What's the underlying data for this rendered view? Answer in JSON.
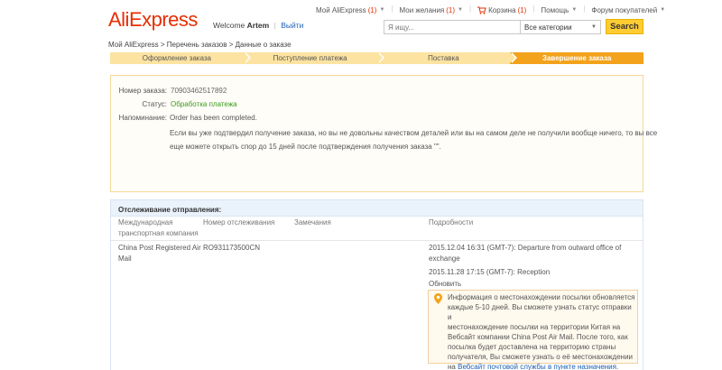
{
  "header": {
    "logo": "AliExpress",
    "welcome_prefix": "Welcome",
    "user_name": "Artem",
    "logout": "Выйти",
    "top_nav": [
      {
        "label": "Мой AliExpress",
        "count": "(1)"
      },
      {
        "label": "Мои желания",
        "count": "(1)"
      },
      {
        "label": "Корзина",
        "count": "(1)"
      },
      {
        "label": "Помощь"
      },
      {
        "label": "Форум покупателей"
      }
    ],
    "search_placeholder": "Я ищу...",
    "category": "Все категории",
    "search_button": "Search"
  },
  "breadcrumb": "Мой AliExpress > Перечень заказов > Данные о заказе",
  "steps": [
    {
      "label": "Оформление заказа",
      "active": false
    },
    {
      "label": "Поступление платежа",
      "active": false
    },
    {
      "label": "Поставка",
      "active": false
    },
    {
      "label": "Завершение заказа",
      "active": true
    }
  ],
  "order": {
    "number_label": "Номер заказа:",
    "number": "70903462517892",
    "status_label": "Статус:",
    "status": "Обработка платежа",
    "reminder_label": "Напоминание:",
    "reminder_line1": "Order has been completed.",
    "reminder_line2": "Если вы уже подтвердил получение заказа, но вы не довольны качеством деталей или вы на самом деле не получили вообще ничего, то вы все",
    "reminder_line3": "еще можете открыть спор до 15 дней после подтверждения получения заказа \"\"."
  },
  "tracking": {
    "title": "Отслеживание отправления:",
    "columns": {
      "carrier_line1": "Международная",
      "carrier_line2": "транспортная компания",
      "tracking_number": "Номер отслеживания",
      "remarks": "Замечания",
      "details": "Подробности"
    },
    "carrier_line1": "China Post Registered Air",
    "carrier_line2": "Mail",
    "tracking_number": "RO931173500CN",
    "event1_line1": "2015.12.04 16:31 (GMT-7): Departure from outward office of",
    "event1_line2": "exchange",
    "event2": "2015.11.28 17:15 (GMT-7): Reception",
    "refresh": "Обновить",
    "info": {
      "line1": "Информация о местонахождении посылки обновляется",
      "line2": "каждые 5-10 дней. Вы сможете узнать статус отправки и",
      "line3": "местонахождение посылки на территории Китая на",
      "line4": "Вебсайт компании China Post Air Mail. После того, как",
      "line5": "посылка будет доставлена на территорию страны",
      "line6": "получателя, Вы сможете узнать о её местонахождении",
      "line7_prefix": "на",
      "line7_link": "Вебсайт почтовой службы в пункте назначения",
      "line7_suffix": "."
    }
  },
  "colors": {
    "brand": "#e62e04",
    "accent": "#f2a21b",
    "link": "#1a5eb4",
    "status_ok": "#3a9b1e",
    "search_button": "#ffcc33"
  }
}
